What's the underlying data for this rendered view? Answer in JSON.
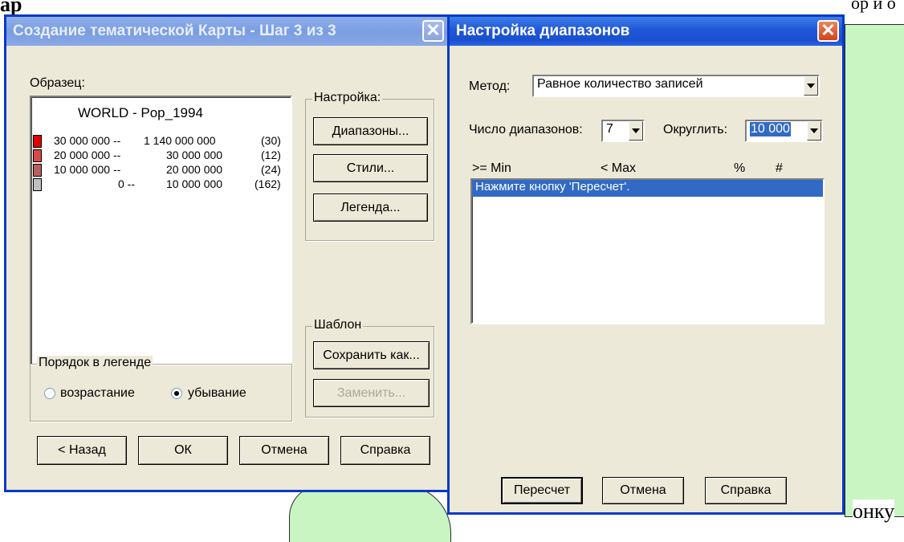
{
  "background": {
    "top_text": "ap",
    "right_text": "онку",
    "top_right_text": "ор и о"
  },
  "wizard": {
    "title": "Создание тематической Карты - Шаг 3 из 3",
    "close_glyph": "✕",
    "sample_label": "Образец:",
    "legend": {
      "title": "WORLD - Pop_1994",
      "rows": [
        {
          "from": "30 000 000 --",
          "to": "1 140 000 000",
          "count": "(30)",
          "color": "#e00000"
        },
        {
          "from": "20 000 000 --",
          "to": "30 000 000",
          "count": "(12)",
          "color": "#d84848"
        },
        {
          "from": "10 000 000 --",
          "to": "20 000 000",
          "count": "(24)",
          "color": "#b86060"
        },
        {
          "from": "0 --",
          "to": "10 000 000",
          "count": "(162)",
          "color": "#c0c0c0"
        }
      ]
    },
    "settings_group": "Настройка:",
    "ranges_button": "Диапазоны...",
    "styles_button": "Стили...",
    "legend_button": "Легенда...",
    "template_group": "Шаблон",
    "save_as_button": "Сохранить как...",
    "replace_button": "Заменить...",
    "order_group": "Порядок в легенде",
    "order_asc": "возрастание",
    "order_desc": "убывание",
    "order_selected": "убывание",
    "back_button": "< Назад",
    "ok_button": "ОК",
    "cancel_button": "Отмена",
    "help_button": "Справка"
  },
  "ranges": {
    "title": "Настройка диапазонов",
    "close_glyph": "✕",
    "method_label": "Метод:",
    "method_value": "Равное количество записей",
    "count_label": "Число диапазонов:",
    "count_value": "7",
    "round_label": "Округлить:",
    "round_value": "10 000",
    "columns": [
      ">= Min",
      "< Max",
      "%",
      "#"
    ],
    "list_message": "Нажмите кнопку 'Пересчет'.",
    "recalc_button": "Пересчет",
    "cancel_button": "Отмена",
    "help_button": "Справка"
  }
}
